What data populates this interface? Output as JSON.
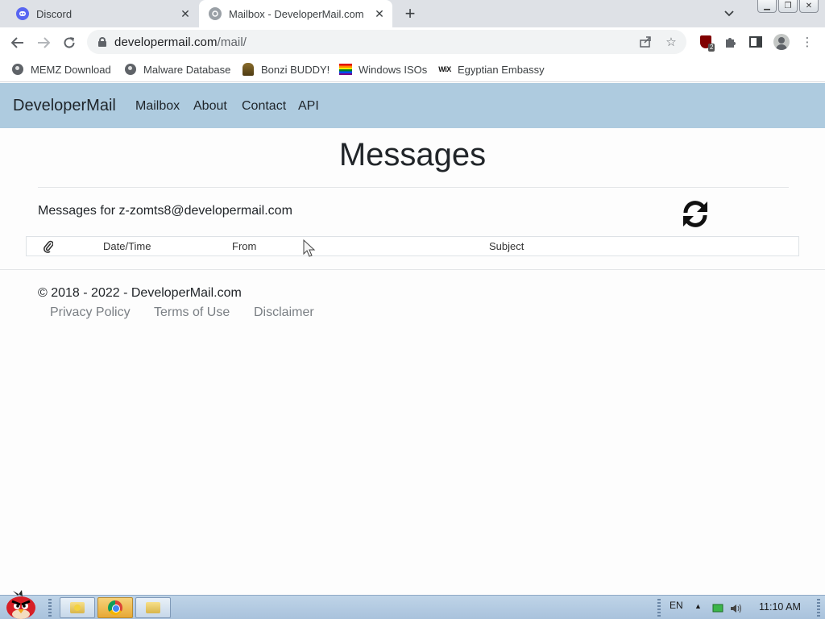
{
  "browser": {
    "tabs": [
      {
        "title": "Discord",
        "active": false,
        "icon": "discord-icon"
      },
      {
        "title": "Mailbox - DeveloperMail.com",
        "active": true,
        "icon": "developermail-icon"
      }
    ],
    "url_host": "developermail.com",
    "url_path": "/mail/",
    "extension_badge": "2",
    "bookmarks": [
      {
        "label": "MEMZ Download",
        "icon": "globe-icon"
      },
      {
        "label": "Malware Database",
        "icon": "globe-icon"
      },
      {
        "label": "Bonzi BUDDY!",
        "icon": "bonzi-icon"
      },
      {
        "label": "Windows ISOs",
        "icon": "rainbow-flag-icon"
      },
      {
        "label": "Egyptian Embassy",
        "icon": "wix-icon"
      }
    ]
  },
  "site": {
    "brand": "DeveloperMail",
    "nav": [
      "Mailbox",
      "About",
      "Contact",
      "API"
    ]
  },
  "page": {
    "title": "Messages",
    "messages_for": "Messages for z-zomts8@developermail.com",
    "table_headers": [
      "Date/Time",
      "From",
      "Subject"
    ]
  },
  "footer": {
    "copyright": "© 2018 - 2022 - DeveloperMail.com",
    "links": [
      "Privacy Policy",
      "Terms of Use",
      "Disclaimer"
    ]
  },
  "taskbar": {
    "language": "EN",
    "clock": "11:10 AM"
  }
}
